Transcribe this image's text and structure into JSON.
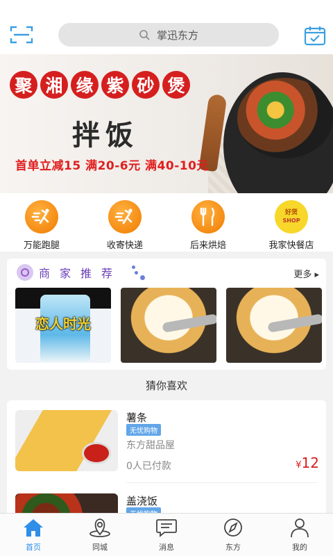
{
  "colors": {
    "accent": "#2f8ee8",
    "price": "#d81e1e",
    "orange": "#f07c00",
    "banner_red": "#d51f1f"
  },
  "topbar": {
    "search_placeholder": "掌迅东方",
    "scan_icon": "scan-icon",
    "calendar_icon": "calendar-check-icon"
  },
  "banner": {
    "title_chars": [
      "聚",
      "湘",
      "缘",
      "紫",
      "砂",
      "煲"
    ],
    "subtitle": "拌饭",
    "promo": "首单立减15 满20-6元 满40-10元"
  },
  "quick_menu": [
    {
      "label": "万能跑腿",
      "icon": "runner-icon"
    },
    {
      "label": "收寄快递",
      "icon": "delivery-runner-icon"
    },
    {
      "label": "后来烘焙",
      "icon": "fork-knife-icon"
    },
    {
      "label": "我家快餐店",
      "icon": "shop-badge-icon",
      "badge_top": "好货",
      "badge_text": "SHOP"
    }
  ],
  "merchants": {
    "title_chars": [
      "商",
      "家",
      "推",
      "荐"
    ],
    "more": "更多 ▸",
    "cards": [
      {
        "caption": "恋人时光",
        "kind": "drink"
      },
      {
        "caption": "",
        "kind": "food"
      },
      {
        "caption": "",
        "kind": "food"
      }
    ]
  },
  "guess": {
    "title": "猜你喜欢"
  },
  "products": [
    {
      "name": "薯条",
      "tag": "无忧购物",
      "shop": "东方甜品屋",
      "paid": "0人已付款",
      "currency": "¥",
      "price": "12"
    },
    {
      "name": "盖浇饭",
      "tag": "无忧购物",
      "shop": "",
      "paid": "",
      "currency": "",
      "price": ""
    }
  ],
  "tabs": [
    {
      "label": "首页",
      "icon": "home-icon",
      "active": true
    },
    {
      "label": "同城",
      "icon": "location-icon",
      "active": false
    },
    {
      "label": "消息",
      "icon": "message-icon",
      "active": false
    },
    {
      "label": "东方",
      "icon": "compass-icon",
      "active": false
    },
    {
      "label": "我的",
      "icon": "user-icon",
      "active": false
    }
  ]
}
